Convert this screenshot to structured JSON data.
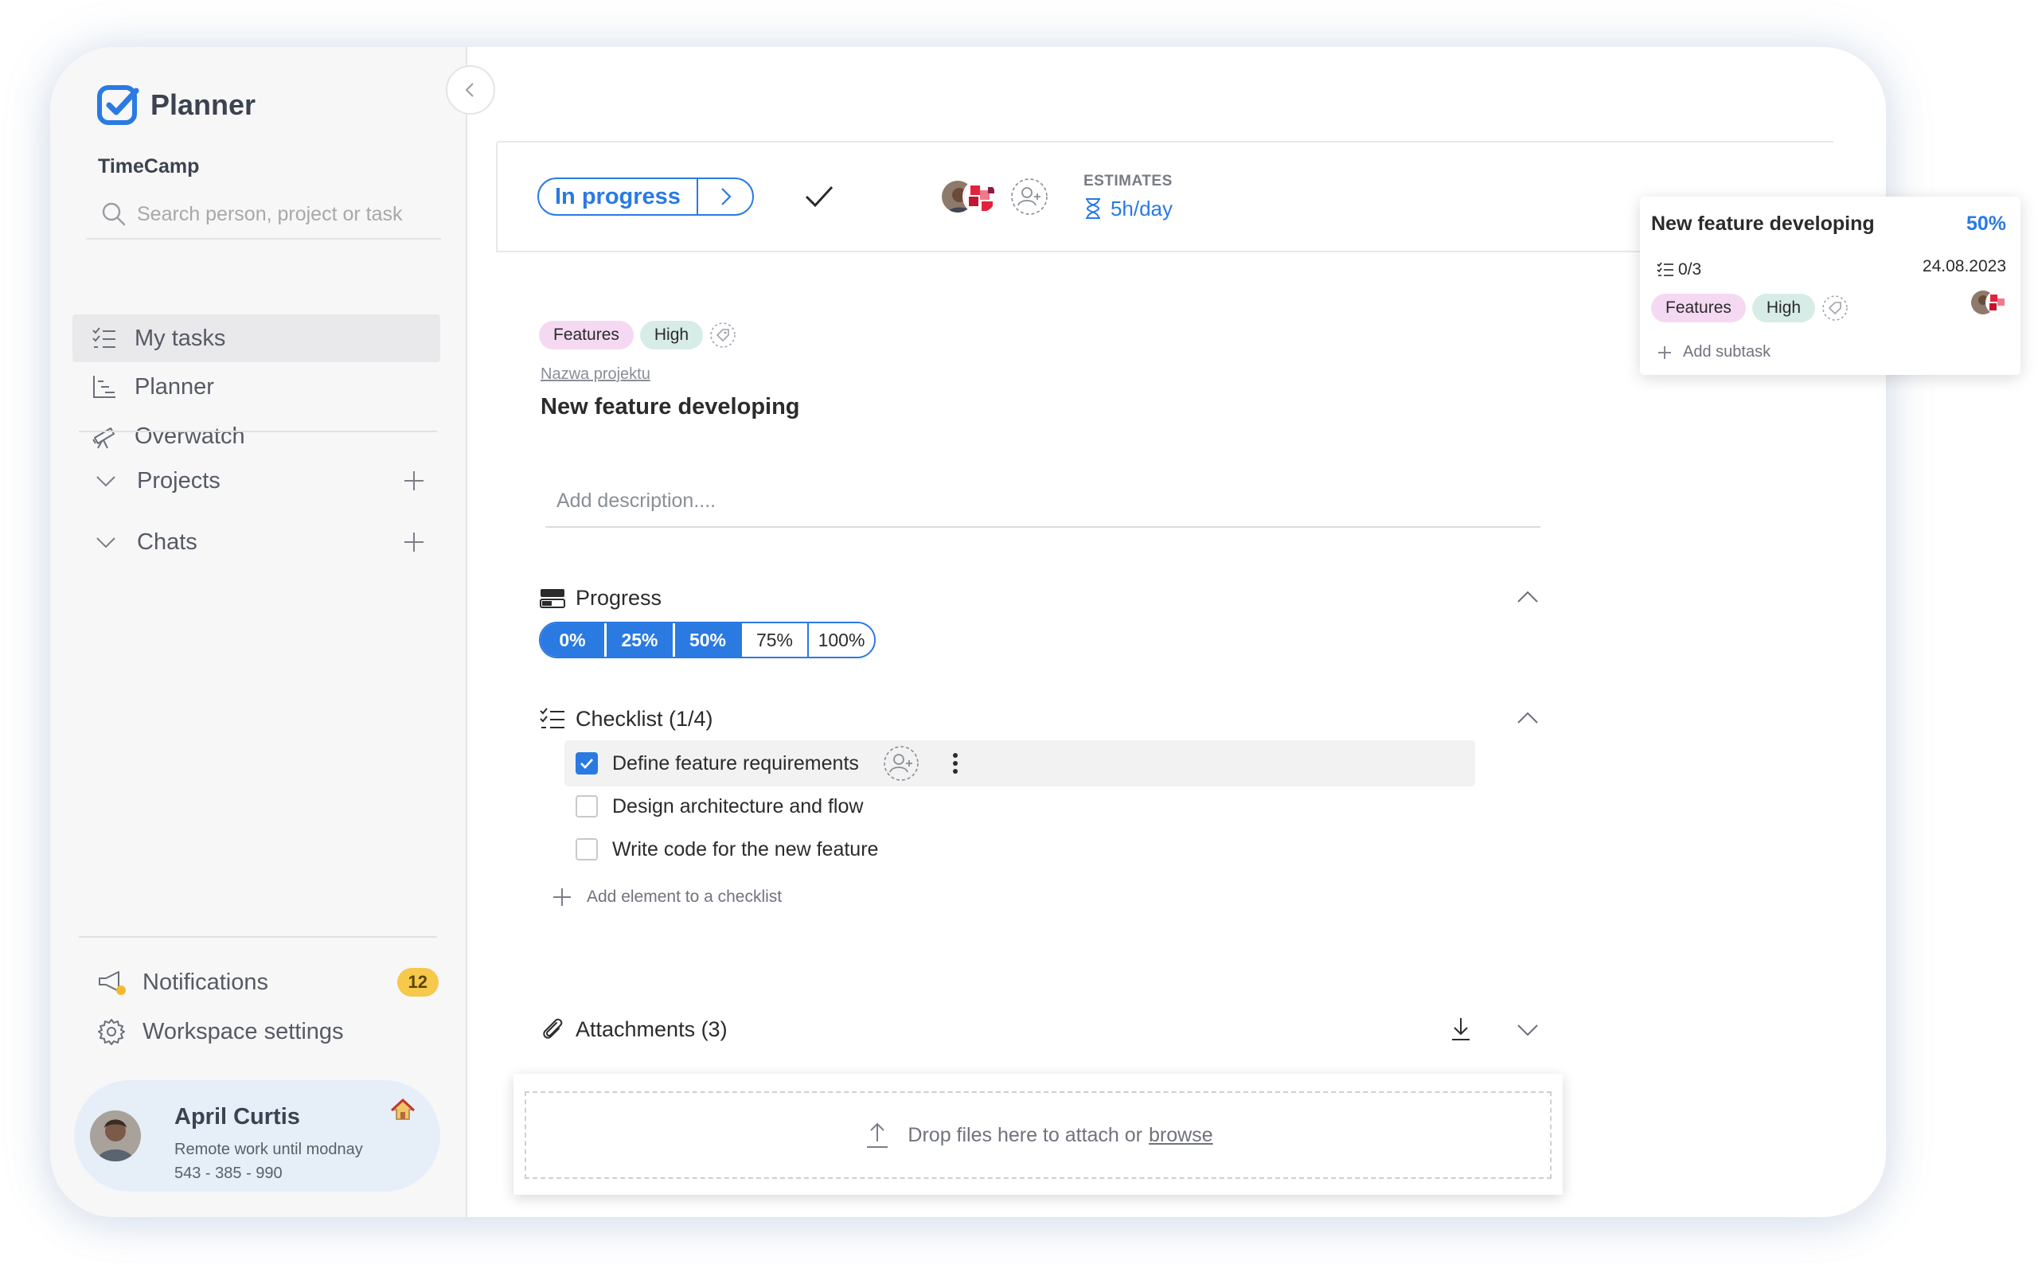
{
  "app": {
    "name": "Planner",
    "workspace": "TimeCamp",
    "brand_color": "#2a7ae2"
  },
  "search": {
    "placeholder": "Search person, project or task"
  },
  "sidebar": {
    "nav": [
      {
        "label": "My tasks",
        "icon": "tasks-list-icon",
        "active": true
      },
      {
        "label": "Planner",
        "icon": "planner-chart-icon",
        "active": false
      },
      {
        "label": "Overwatch",
        "icon": "telescope-icon",
        "active": false
      }
    ],
    "sections": [
      {
        "label": "Projects",
        "icon": "chevron-down-icon",
        "action_icon": "plus-icon"
      },
      {
        "label": "Chats",
        "icon": "chevron-down-icon",
        "action_icon": "plus-icon"
      }
    ],
    "bottom": [
      {
        "label": "Notifications",
        "icon": "megaphone-icon",
        "badge": "12"
      },
      {
        "label": "Workspace settings",
        "icon": "gear-icon"
      }
    ],
    "user": {
      "name": "April Curtis",
      "status": "Remote work until modnay",
      "phone": "543 - 385 - 990",
      "status_icon": "home-icon"
    }
  },
  "task": {
    "status": "In progress",
    "estimates_label": "ESTIMATES",
    "estimate_value": "5h/day",
    "tags": [
      {
        "label": "Features",
        "color": "#f5d9f2"
      },
      {
        "label": "High",
        "color": "#d7ece7"
      }
    ],
    "project": "Nazwa projektu",
    "title": "New feature developing",
    "description_placeholder": "Add description....",
    "progress": {
      "label": "Progress",
      "options": [
        "0%",
        "25%",
        "50%",
        "75%",
        "100%"
      ],
      "selected": "50%",
      "value": 0.5
    },
    "checklist": {
      "label": "Checklist (1/4)",
      "items": [
        {
          "text": "Define feature requirements",
          "done": true
        },
        {
          "text": "Design architecture and flow",
          "done": false
        },
        {
          "text": "Write code for the new feature",
          "done": false
        }
      ],
      "add_label": "Add element to a checklist"
    },
    "attachments": {
      "label": "Attachments (3)",
      "drop_text": "Drop files here to attach or",
      "browse_label": "browse"
    }
  },
  "popup": {
    "title": "New feature developing",
    "percent": "50%",
    "subtasks": "0/3",
    "date": "24.08.2023",
    "tags": [
      "Features",
      "High"
    ],
    "add_subtask": "Add subtask"
  }
}
